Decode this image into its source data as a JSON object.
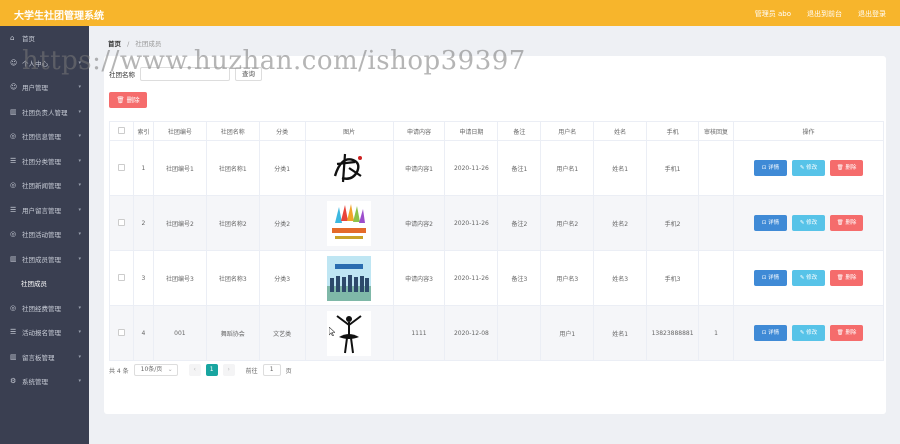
{
  "app": {
    "title": "大学生社团管理系统"
  },
  "header": {
    "user": "管理员 abo",
    "back_home": "退出到前台",
    "logout": "退出登录"
  },
  "sidebar": {
    "items": [
      {
        "icon": "home-icon",
        "glyph": "⌂",
        "label": "首页",
        "arrow": false
      },
      {
        "icon": "user-icon",
        "glyph": "☺",
        "label": "个人中心",
        "arrow": true
      },
      {
        "icon": "user-icon",
        "glyph": "☺",
        "label": "用户管理",
        "arrow": true
      },
      {
        "icon": "chart-icon",
        "glyph": "▥",
        "label": "社团负责人管理",
        "arrow": true
      },
      {
        "icon": "circle-icon",
        "glyph": "◎",
        "label": "社团信息管理",
        "arrow": true
      },
      {
        "icon": "list-icon",
        "glyph": "☰",
        "label": "社团分类管理",
        "arrow": true
      },
      {
        "icon": "circle-icon",
        "glyph": "◎",
        "label": "社团新闻管理",
        "arrow": true
      },
      {
        "icon": "list-icon",
        "glyph": "☰",
        "label": "用户留言管理",
        "arrow": true
      },
      {
        "icon": "circle-icon",
        "glyph": "◎",
        "label": "社团活动管理",
        "arrow": true
      },
      {
        "icon": "chart-icon",
        "glyph": "▥",
        "label": "社团成员管理",
        "arrow": true
      },
      {
        "icon": "",
        "glyph": "",
        "label": "社团成员",
        "arrow": false,
        "sub": true
      },
      {
        "icon": "circle-icon",
        "glyph": "◎",
        "label": "社团经费管理",
        "arrow": true
      },
      {
        "icon": "list-icon",
        "glyph": "☰",
        "label": "活动报名管理",
        "arrow": true
      },
      {
        "icon": "chart-icon",
        "glyph": "▥",
        "label": "留言板管理",
        "arrow": true
      },
      {
        "icon": "gear-icon",
        "glyph": "⚙",
        "label": "系统管理",
        "arrow": true
      }
    ]
  },
  "breadcrumb": {
    "home": "首页",
    "sep": "/",
    "current": "社团成员"
  },
  "search": {
    "label": "社团名称",
    "button": "查询"
  },
  "toolbar": {
    "delete_label": "🗑 删除"
  },
  "table": {
    "columns": [
      "",
      "索引",
      "社团编号",
      "社团名称",
      "分类",
      "图片",
      "申请内容",
      "申请日期",
      "备注",
      "用户名",
      "姓名",
      "手机",
      "审核回复",
      "操作"
    ],
    "rows": [
      {
        "index": "1",
        "code": "社团编号1",
        "name": "社团名称1",
        "category": "分类1",
        "image": "calligraphy",
        "content": "申请内容1",
        "date": "2020-11-26",
        "note": "备注1",
        "username": "用户名1",
        "realname": "姓名1",
        "phone": "手机1",
        "reply": ""
      },
      {
        "index": "2",
        "code": "社团编号2",
        "name": "社团名称2",
        "category": "分类2",
        "image": "hands",
        "content": "申请内容2",
        "date": "2020-11-26",
        "note": "备注2",
        "username": "用户名2",
        "realname": "姓名2",
        "phone": "手机2",
        "reply": ""
      },
      {
        "index": "3",
        "code": "社团编号3",
        "name": "社团名称3",
        "category": "分类3",
        "image": "group",
        "content": "申请内容3",
        "date": "2020-11-26",
        "note": "备注3",
        "username": "用户名3",
        "realname": "姓名3",
        "phone": "手机3",
        "reply": ""
      },
      {
        "index": "4",
        "code": "001",
        "name": "舞蹈协会",
        "category": "文艺类",
        "image": "dancer",
        "content": "1111",
        "date": "2020-12-08",
        "note": "",
        "username": "用户1",
        "realname": "姓名1",
        "phone": "13823888881",
        "reply": "1"
      }
    ],
    "actions": {
      "detail": "⊡ 详情",
      "edit": "✎ 修改",
      "delete": "🗑 删除"
    }
  },
  "pagination": {
    "total": "共 4 条",
    "page_size": "10条/页",
    "prev": "‹",
    "current": "1",
    "next": "›",
    "goto": "前往",
    "goto_value": "1",
    "page_unit": "页"
  },
  "watermark": "https://www.huzhan.com/ishop39397",
  "colors": {
    "topbar": "#f7b52c",
    "sidebar": "#3a3f51",
    "detail": "#3f8ad6",
    "edit": "#57c3e8",
    "delete": "#f56c6c",
    "active_page": "#18a5a0"
  }
}
